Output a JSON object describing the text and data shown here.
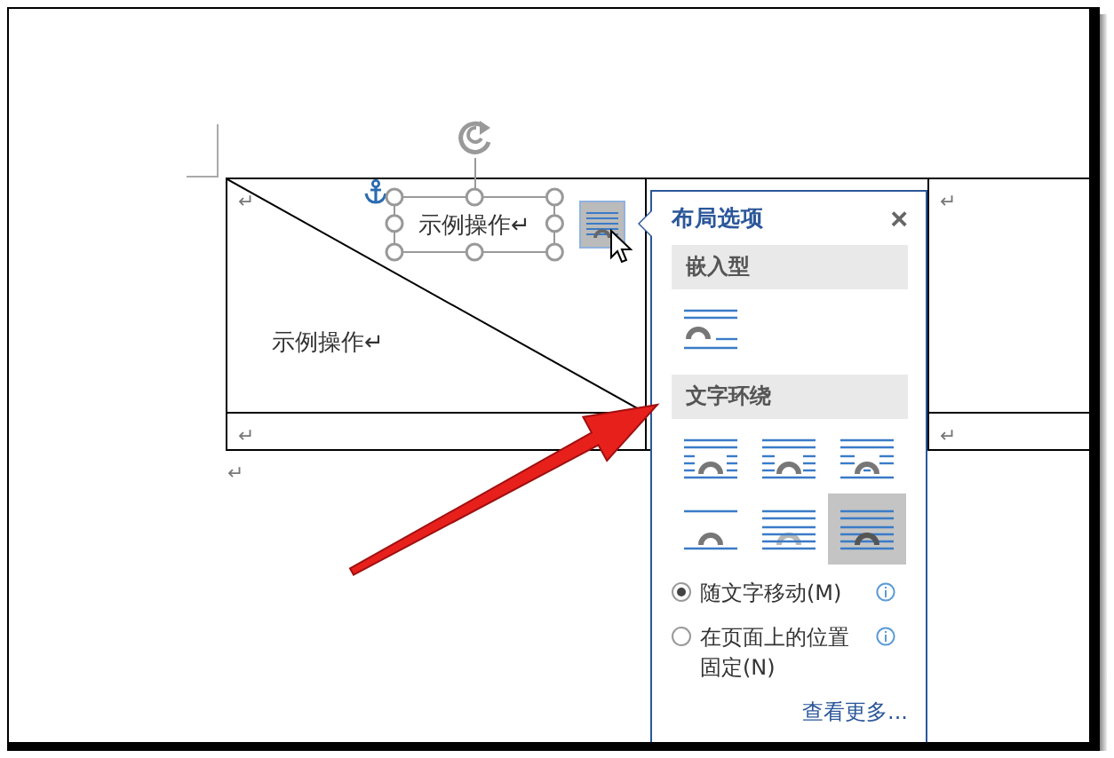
{
  "document": {
    "table": {
      "rows": [
        {
          "cells": [
            {
              "mark": "↵",
              "text": "示例操作↵"
            },
            {},
            {
              "mark": "↵"
            }
          ]
        },
        {
          "cells": [
            {
              "mark": "↵"
            },
            {},
            {
              "mark": "↵"
            }
          ]
        }
      ]
    },
    "after_table_mark": "↵",
    "text_box": {
      "text": "示例操作↵"
    }
  },
  "layout_options": {
    "title": "布局选项",
    "close": "×",
    "sections": [
      {
        "heading": "嵌入型",
        "options": [
          {
            "kind": "inline",
            "selected": false
          }
        ]
      },
      {
        "heading": "文字环绕",
        "options": [
          {
            "kind": "square",
            "selected": false
          },
          {
            "kind": "tight",
            "selected": false
          },
          {
            "kind": "through",
            "selected": false
          },
          {
            "kind": "top-bottom",
            "selected": false
          },
          {
            "kind": "behind",
            "selected": false
          },
          {
            "kind": "front",
            "selected": true
          }
        ]
      }
    ],
    "radios": [
      {
        "label": "随文字移动(M)",
        "selected": true
      },
      {
        "label": "在页面上的位置固定(N)",
        "selected": false
      }
    ],
    "link": "查看更多..."
  }
}
